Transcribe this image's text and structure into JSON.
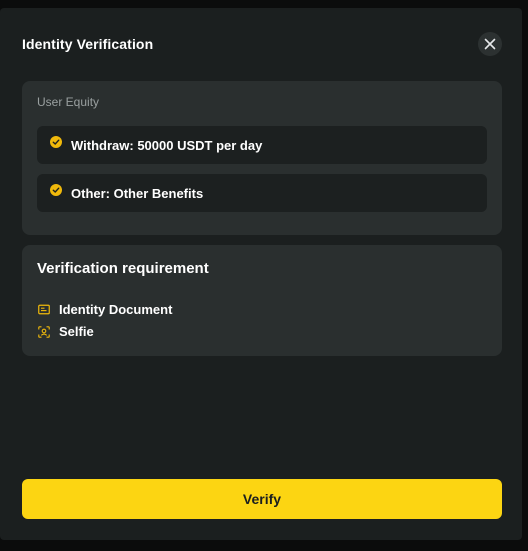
{
  "dialog": {
    "title": "Identity Verification"
  },
  "equity": {
    "label": "User Equity",
    "benefits": [
      {
        "text": "Withdraw: 50000 USDT per day",
        "icon": "check-circle-icon"
      },
      {
        "text": "Other: Other Benefits",
        "icon": "check-circle-icon"
      }
    ]
  },
  "requirements": {
    "title": "Verification requirement",
    "items": [
      {
        "label": "Identity Document",
        "icon": "id-card-icon"
      },
      {
        "label": "Selfie",
        "icon": "face-scan-icon"
      }
    ]
  },
  "actions": {
    "verify_label": "Verify"
  },
  "colors": {
    "accent": "#fcd512",
    "check": "#f0b90b",
    "background": "#1b1f1f",
    "card": "#2a2f2f",
    "row": "#1c2020"
  }
}
